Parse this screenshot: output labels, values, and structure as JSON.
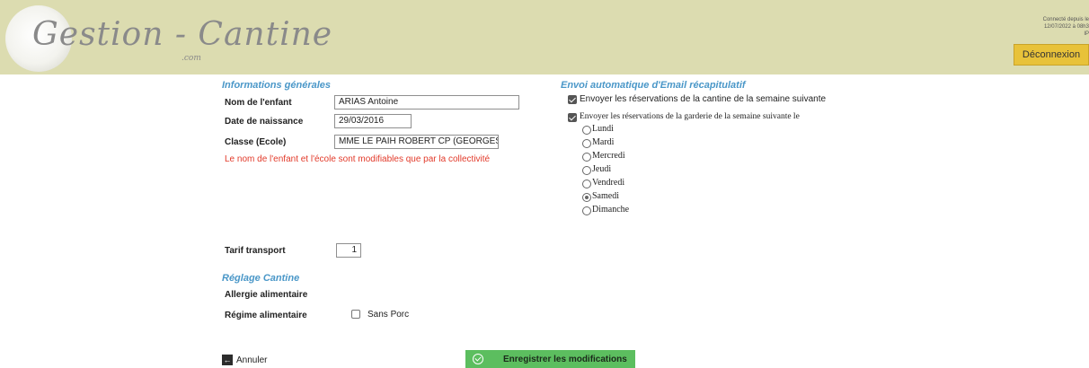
{
  "header": {
    "logo_text": "Gestion - Cantine",
    "logo_sub": ".com",
    "connection_line1": "Connecté depuis le",
    "connection_line2": "12/07/2022 à 08h3",
    "connection_line3": "IP",
    "logout_label": "Déconnexion"
  },
  "general": {
    "title": "Informations générales",
    "name_label": "Nom de l'enfant",
    "name_value": "ARIAS Antoine",
    "birth_label": "Date de naissance",
    "birth_value": "29/03/2016",
    "class_label": "Classe (Ecole)",
    "class_value": "MME LE PAIH ROBERT CP (GEORGES BRU",
    "warning": "Le nom de l'enfant et l'école sont modifiables que par la collectivité"
  },
  "email": {
    "title": "Envoi automatique d'Email récapitulatif",
    "cantine_label": "Envoyer les réservations de la cantine de la semaine suivante",
    "cantine_checked": true,
    "garderie_label": "Envoyer les réservations de la garderie de la semaine suivante le",
    "garderie_checked": true,
    "days": [
      "Lundi",
      "Mardi",
      "Mercredi",
      "Jeudi",
      "Vendredi",
      "Samedi",
      "Dimanche"
    ],
    "selected_day": "Samedi"
  },
  "transport": {
    "label": "Tarif transport",
    "value": "1"
  },
  "cantine": {
    "title": "Réglage Cantine",
    "allergy_label": "Allergie alimentaire",
    "diet_label": "Régime alimentaire",
    "diet_option": "Sans Porc",
    "diet_checked": false
  },
  "actions": {
    "cancel_label": "Annuler",
    "save_label": "Enregistrer les modifications"
  },
  "colors": {
    "header_bg": "#dcdcb0",
    "accent": "#4a97c8",
    "warning": "#e23a2a",
    "save_green": "#5cbe5f",
    "logout_yellow": "#e8c23a"
  }
}
